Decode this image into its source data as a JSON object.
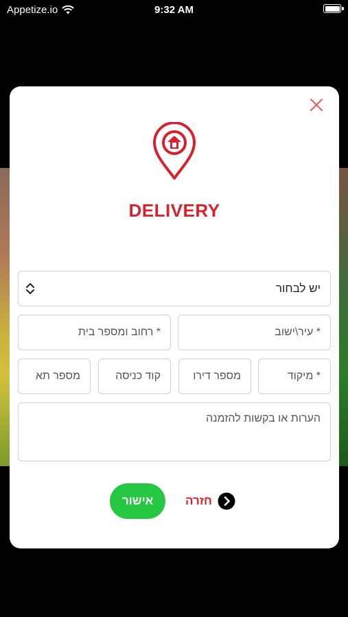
{
  "status_bar": {
    "carrier": "Appetize.io",
    "time": "9:32 AM",
    "wifi_icon": "wifi-icon",
    "battery_level": 1.0
  },
  "modal": {
    "title": "DELIVERY",
    "close_icon": "close-icon",
    "pin_icon": "location-home-pin-icon",
    "brand_color": "#d6222c",
    "select": {
      "value": "יש לבחור",
      "icon": "chevron-up-down-icon"
    },
    "fields": {
      "city": "* עיר\\ישוב",
      "street": "* רחוב ומספר בית",
      "zip": "* מיקוד",
      "apartment": "מספר דירו",
      "entry_code": "קוד כניסה",
      "mailbox": "מספר תא",
      "notes": "הערות או בקשות להזמנה"
    },
    "confirm_label": "אישור",
    "confirm_color": "#26c743",
    "back_label": "חזרה",
    "back_icon": "chevron-right-circle-icon"
  }
}
